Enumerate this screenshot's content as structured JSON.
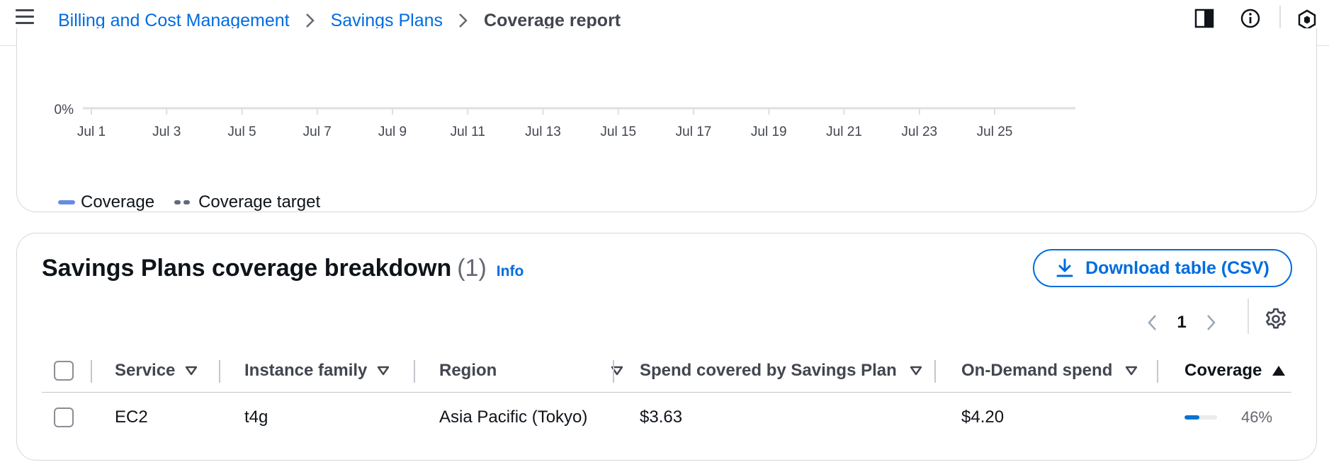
{
  "breadcrumb": {
    "items": [
      "Billing and Cost Management",
      "Savings Plans"
    ],
    "current": "Coverage report"
  },
  "chart_data": {
    "type": "line",
    "y_ticks": [
      "0%"
    ],
    "x_ticks": [
      "Jul 1",
      "Jul 3",
      "Jul 5",
      "Jul 7",
      "Jul 9",
      "Jul 11",
      "Jul 13",
      "Jul 15",
      "Jul 17",
      "Jul 19",
      "Jul 21",
      "Jul 23",
      "Jul 25"
    ],
    "series": [
      {
        "name": "Coverage",
        "color": "#688ae8",
        "style": "solid"
      },
      {
        "name": "Coverage target",
        "color": "#5f6b7a",
        "style": "dashed"
      }
    ],
    "legend": "bottom-left"
  },
  "table": {
    "title": "Savings Plans coverage breakdown",
    "count": "(1)",
    "info": "Info",
    "download_label": "Download table (CSV)",
    "page": "1",
    "columns": [
      "Service",
      "Instance family",
      "Region",
      "Spend covered by Savings Plan",
      "On-Demand spend",
      "Coverage"
    ],
    "rows": [
      {
        "service": "EC2",
        "instance_family": "t4g",
        "region": "Asia Pacific (Tokyo)",
        "spend_covered": "$3.63",
        "on_demand": "$4.20",
        "coverage": "46%",
        "coverage_fraction": 0.46
      }
    ]
  },
  "colors": {
    "link": "#006ce0",
    "coverage_fill": "#0972d3"
  }
}
